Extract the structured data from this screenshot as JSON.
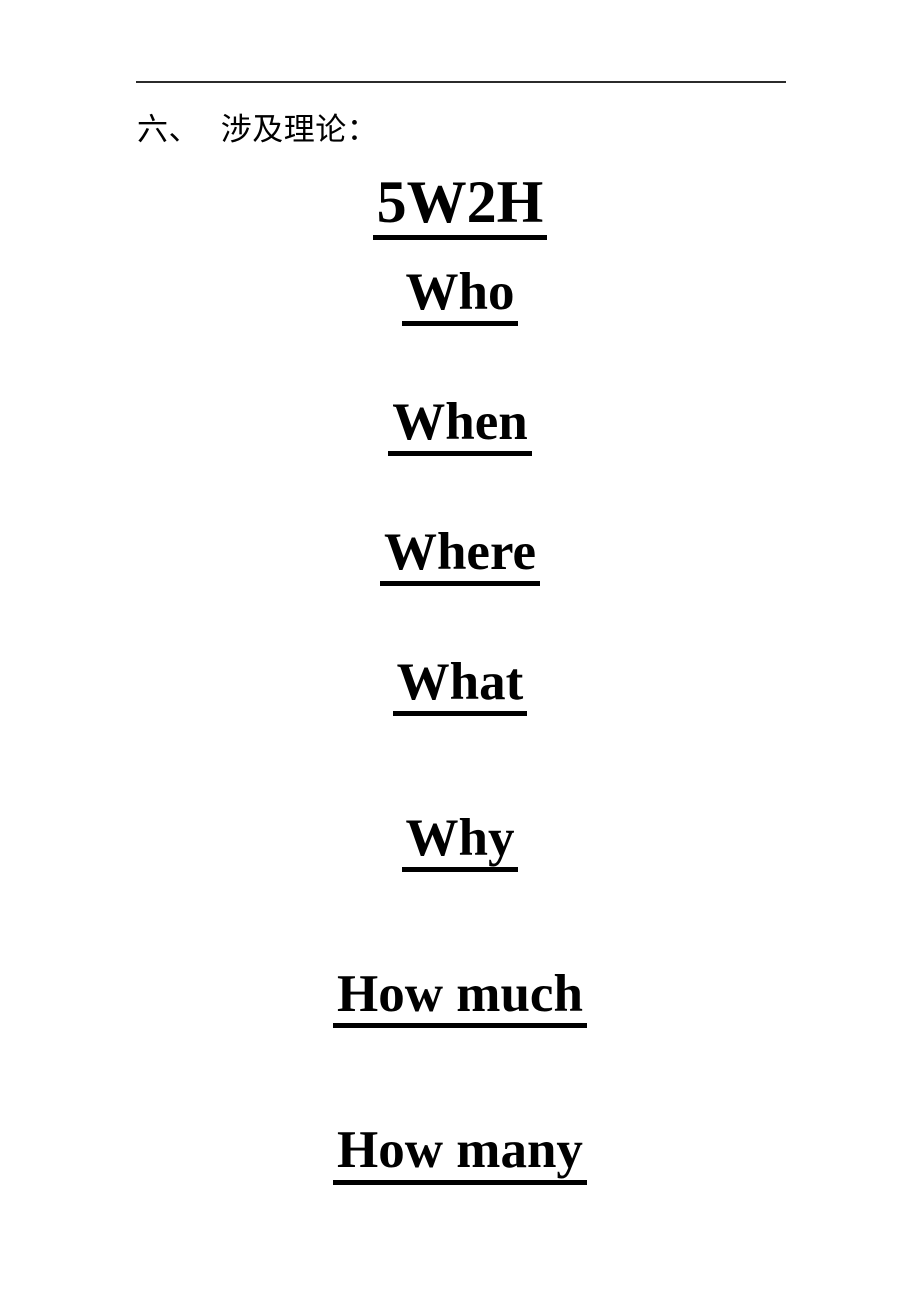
{
  "document": {
    "page_background": "#ffffff",
    "text_color": "#000000",
    "rule_color": "#2b2b2b"
  },
  "header": {
    "rule": "horizontal-rule",
    "section_heading": "六、  涉及理论："
  },
  "content": {
    "title": "5W2H",
    "items": [
      {
        "label": "Who"
      },
      {
        "label": "When"
      },
      {
        "label": "Where"
      },
      {
        "label": "What"
      },
      {
        "label": "Why"
      },
      {
        "label": "How much"
      },
      {
        "label": "How many"
      }
    ]
  }
}
